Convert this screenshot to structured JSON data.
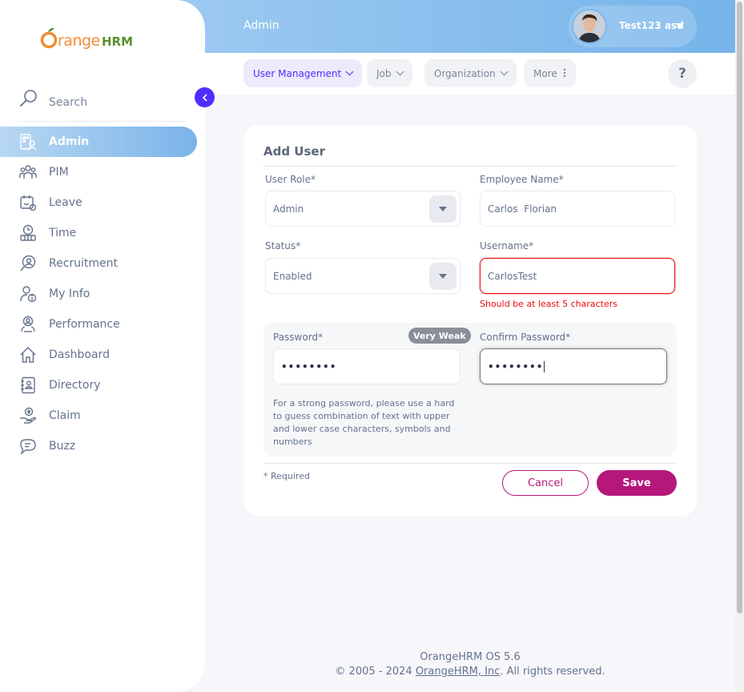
{
  "brand": {
    "name_part1": "range",
    "name_part2": "HRM",
    "initial": "O"
  },
  "topbar": {
    "title": "Admin",
    "user_name": "Test123 asd"
  },
  "nav": {
    "tabs": [
      {
        "label": "User Management"
      },
      {
        "label": "Job"
      },
      {
        "label": "Organization"
      },
      {
        "label": "More"
      }
    ],
    "help_label": "?"
  },
  "sidebar": {
    "search_label": "Search",
    "items": [
      {
        "label": "Admin",
        "icon": "admin-icon",
        "active": true
      },
      {
        "label": "PIM",
        "icon": "pim-icon"
      },
      {
        "label": "Leave",
        "icon": "leave-icon"
      },
      {
        "label": "Time",
        "icon": "time-icon"
      },
      {
        "label": "Recruitment",
        "icon": "recruitment-icon"
      },
      {
        "label": "My Info",
        "icon": "my-info-icon"
      },
      {
        "label": "Performance",
        "icon": "performance-icon"
      },
      {
        "label": "Dashboard",
        "icon": "dashboard-icon"
      },
      {
        "label": "Directory",
        "icon": "directory-icon"
      },
      {
        "label": "Claim",
        "icon": "claim-icon"
      },
      {
        "label": "Buzz",
        "icon": "buzz-icon"
      }
    ]
  },
  "form": {
    "title": "Add User",
    "user_role": {
      "label": "User Role*",
      "value": "Admin"
    },
    "employee_name": {
      "label": "Employee Name*",
      "value": "Carlos  Florian"
    },
    "status": {
      "label": "Status*",
      "value": "Enabled"
    },
    "username": {
      "label": "Username*",
      "value": "CarlosTest",
      "error": "Should be at least 5 characters"
    },
    "password": {
      "label": "Password*",
      "value": "••••••••",
      "strength": "Very Weak"
    },
    "confirm_password": {
      "label": "Confirm Password*",
      "value": "••••••••"
    },
    "hint": "For a strong password, please use a hard to guess combination of text with upper and lower case characters, symbols and numbers",
    "required_note": "* Required",
    "cancel_label": "Cancel",
    "save_label": "Save"
  },
  "footer": {
    "version": "OrangeHRM OS 5.6",
    "copyright_prefix": "© 2005 - 2024 ",
    "company_link": "OrangeHRM, Inc",
    "copyright_suffix": ". All rights reserved."
  },
  "colors": {
    "accent": "#b5177b",
    "primary": "#4e2dff",
    "error": "#eb0910",
    "topbar": "#76b4ea"
  }
}
